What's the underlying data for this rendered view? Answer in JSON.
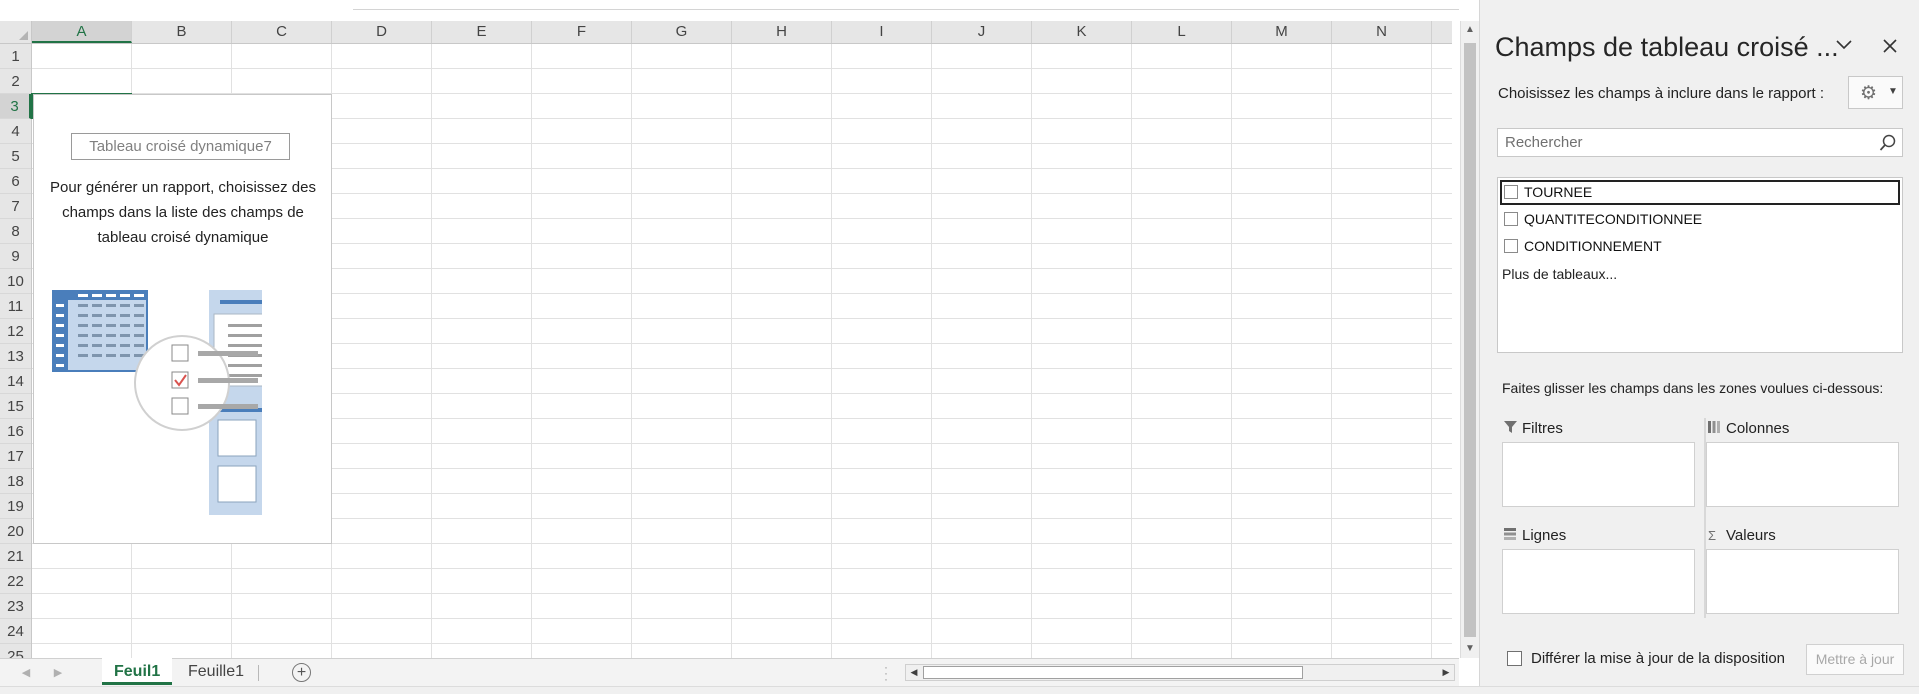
{
  "spreadsheet": {
    "columns": [
      "A",
      "B",
      "C",
      "D",
      "E",
      "F",
      "G",
      "H",
      "I",
      "J",
      "K",
      "L",
      "M",
      "N"
    ],
    "rows": [
      "1",
      "2",
      "3",
      "4",
      "5",
      "6",
      "7",
      "8",
      "9",
      "10",
      "11",
      "12",
      "13",
      "14",
      "15",
      "16",
      "17",
      "18",
      "19",
      "20",
      "21",
      "22",
      "23",
      "24",
      "25"
    ],
    "selected_cell": "A3"
  },
  "pivot_placeholder": {
    "name": "Tableau croisé dynamique7",
    "instructions": "Pour générer un rapport, choisissez des champs dans la liste des champs de tableau croisé dynamique"
  },
  "sheet_tabs": [
    {
      "label": "Feuil1",
      "active": true
    },
    {
      "label": "Feuille1",
      "active": false
    }
  ],
  "pane": {
    "title": "Champs de tableau croisé ...",
    "subtitle": "Choisissez les champs à inclure dans le rapport :",
    "search_placeholder": "Rechercher",
    "fields": [
      {
        "label": "TOURNEE",
        "checked": false,
        "focused": true
      },
      {
        "label": "QUANTITECONDITIONNEE",
        "checked": false,
        "focused": false
      },
      {
        "label": "CONDITIONNEMENT",
        "checked": false,
        "focused": false
      }
    ],
    "more_tables": "Plus de tableaux...",
    "drag_hint": "Faites glisser les champs dans les zones voulues ci-dessous:",
    "zones": {
      "filters": "Filtres",
      "columns": "Colonnes",
      "rows": "Lignes",
      "values": "Valeurs"
    },
    "defer_label": "Différer la mise à jour de la disposition",
    "update_button": "Mettre à jour"
  },
  "colors": {
    "excel_green": "#217346",
    "illustration_blue": "#4a7ebb",
    "illustration_light": "#c5d7ec",
    "check_red": "#d9534f"
  },
  "icons": [
    "gear-icon",
    "search-icon",
    "close-icon",
    "chevron-down-icon",
    "filter-icon",
    "columns-icon",
    "rows-icon",
    "sigma-icon",
    "plus-icon"
  ]
}
